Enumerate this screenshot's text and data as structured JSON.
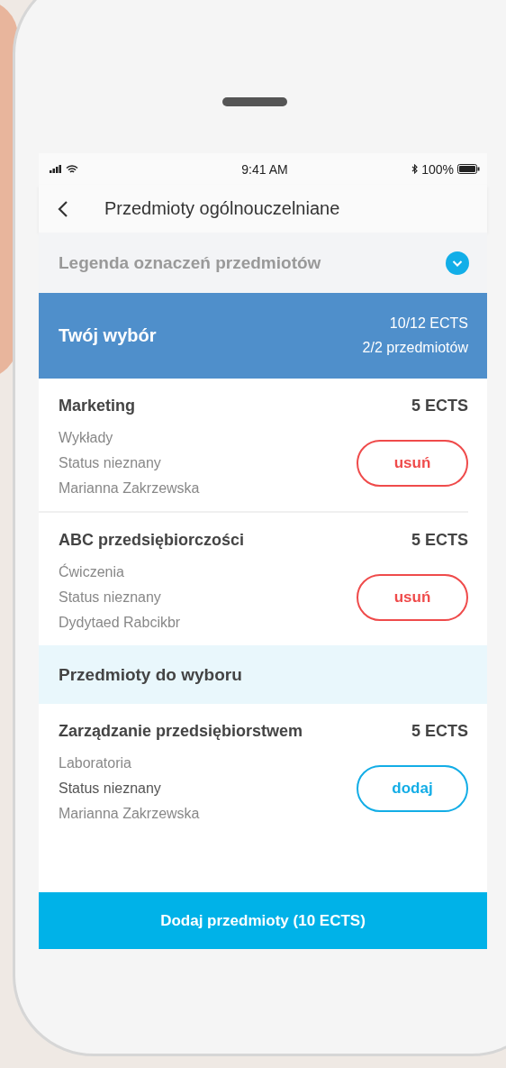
{
  "status_bar": {
    "time": "9:41 AM",
    "battery": "100%"
  },
  "nav": {
    "title": "Przedmioty ogólnouczelniane"
  },
  "legend": {
    "label": "Legenda oznaczeń przedmiotów",
    "expanded": false
  },
  "selection": {
    "title": "Twój wybór",
    "ects": "10/12 ECTS",
    "count": "2/2 przedmiotów"
  },
  "selected_courses": [
    {
      "name": "Marketing",
      "ects": "5 ECTS",
      "type": "Wykłady",
      "status": "Status nieznany",
      "status_emphasized": false,
      "lecturer": "Marianna Zakrzewska",
      "action": {
        "kind": "remove",
        "label": "usuń"
      }
    },
    {
      "name": "ABC przedsiębiorczości",
      "ects": "5 ECTS",
      "type": "Ćwiczenia",
      "status": "Status nieznany",
      "status_emphasized": false,
      "lecturer": "Dydytaed Rabcikbr",
      "action": {
        "kind": "remove",
        "label": "usuń"
      }
    }
  ],
  "available_section": {
    "title": "Przedmioty do wyboru"
  },
  "available_courses": [
    {
      "name": "Zarządzanie przedsiębiorstwem",
      "ects": "5 ECTS",
      "type": "Laboratoria",
      "status": "Status nieznany",
      "status_emphasized": true,
      "lecturer": "Marianna Zakrzewska",
      "action": {
        "kind": "add",
        "label": "dodaj"
      }
    }
  ],
  "footer_button": {
    "label": "Dodaj przedmioty (10 ECTS)"
  }
}
